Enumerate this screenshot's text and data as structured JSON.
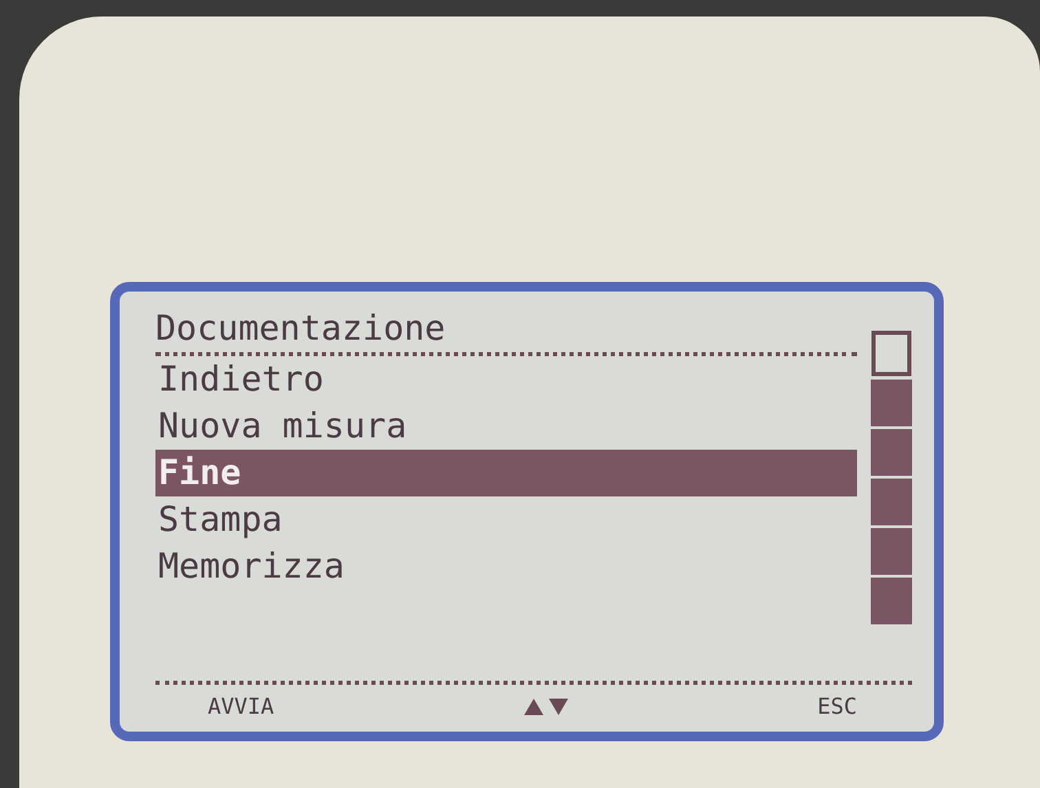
{
  "screen": {
    "title": "Documentazione",
    "menu": [
      {
        "label": "Indietro",
        "selected": false
      },
      {
        "label": "Nuova misura",
        "selected": false
      },
      {
        "label": "Fine",
        "selected": true
      },
      {
        "label": "Stampa",
        "selected": false
      },
      {
        "label": "Memorizza",
        "selected": false
      }
    ],
    "softkeys": [
      {
        "kind": "text",
        "label": "AVVIA"
      },
      {
        "kind": "updown"
      },
      {
        "kind": "text",
        "label": "ESC"
      }
    ]
  }
}
